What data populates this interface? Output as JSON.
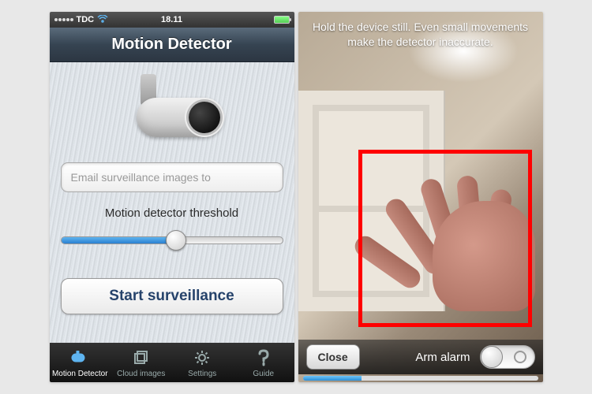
{
  "status": {
    "carrier": "TDC",
    "time": "18.11"
  },
  "screen1": {
    "title": "Motion Detector",
    "email_placeholder": "Email surveillance images to",
    "threshold_label": "Motion detector threshold",
    "threshold_value": 0.52,
    "start_button": "Start surveillance",
    "tabs": [
      {
        "label": "Motion Detector"
      },
      {
        "label": "Cloud images"
      },
      {
        "label": "Settings"
      },
      {
        "label": "Guide"
      }
    ]
  },
  "screen2": {
    "hint": "Hold the device still. Even small movements make the detector inaccurate.",
    "close_label": "Close",
    "arm_label": "Arm alarm",
    "armed": false,
    "progress": 0.25
  }
}
